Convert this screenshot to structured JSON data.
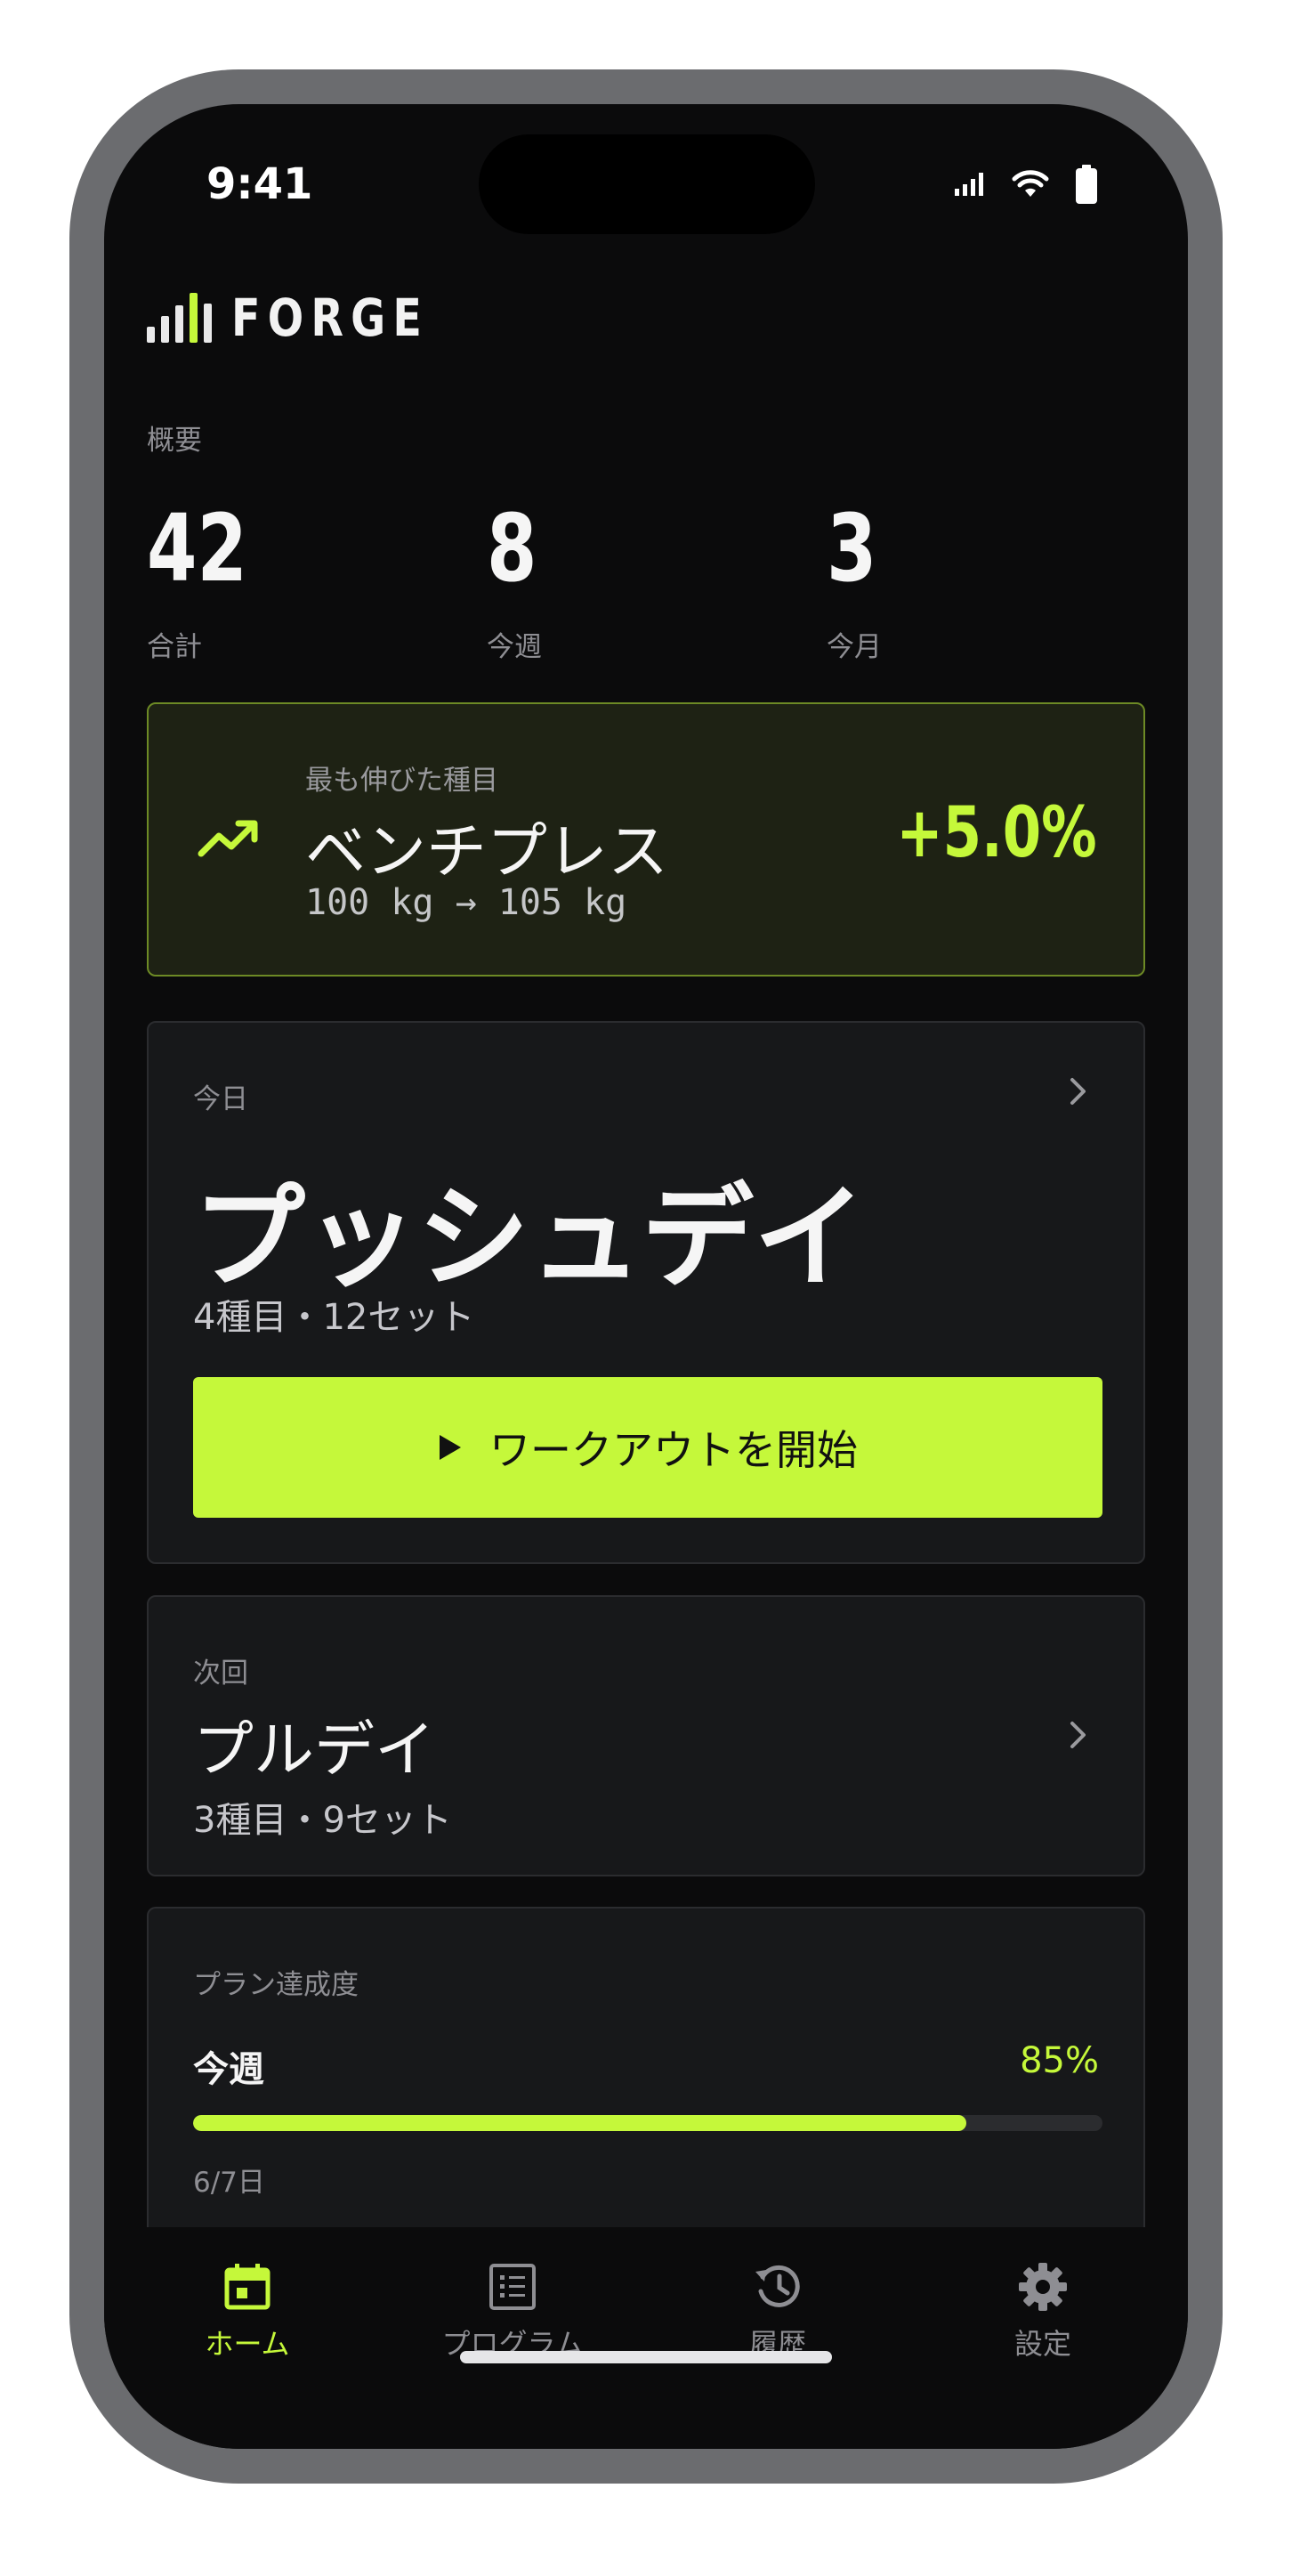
{
  "status_bar": {
    "time": "9:41"
  },
  "app": {
    "brand": "FORGE"
  },
  "overview": {
    "label": "概要",
    "stats": [
      {
        "value": "42",
        "label": "合計"
      },
      {
        "value": "8",
        "label": "今週"
      },
      {
        "value": "3",
        "label": "今月"
      }
    ]
  },
  "highlight": {
    "label": "最も伸びた種目",
    "exercise": "ベンチプレス",
    "change": "100 kg → 105 kg",
    "percent": "+5.0%"
  },
  "today": {
    "kicker": "今日",
    "title": "プッシュデイ",
    "meta": "4種目・12セット",
    "start_label": "ワークアウトを開始"
  },
  "next": {
    "kicker": "次回",
    "title": "プルデイ",
    "meta": "3種目・9セット"
  },
  "plan": {
    "label": "プラン達成度",
    "period": "今週",
    "percent_text": "85%",
    "progress_fraction": 0.85,
    "days": "6/7日"
  },
  "tabs": [
    {
      "label": "ホーム",
      "icon": "calendar-icon",
      "active": true
    },
    {
      "label": "プログラム",
      "icon": "list-icon",
      "active": false
    },
    {
      "label": "履歴",
      "icon": "history-icon",
      "active": false
    },
    {
      "label": "設定",
      "icon": "gear-icon",
      "active": false
    }
  ],
  "colors": {
    "accent": "#c5f83a",
    "background": "#0b0b0c",
    "card": "#17181a"
  }
}
